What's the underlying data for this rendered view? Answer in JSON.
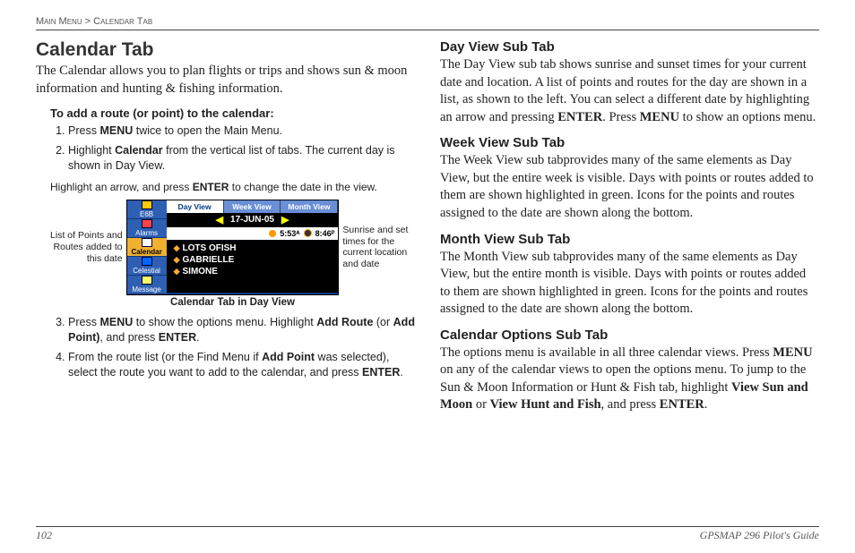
{
  "header": {
    "crumb1": "Main Menu",
    "sep": ">",
    "crumb2": "Calendar Tab"
  },
  "left": {
    "h1": "Calendar Tab",
    "intro": "The Calendar allows you to plan flights or trips and shows sun & moon information and hunting & fishing information.",
    "task_heading": "To add a route (or point) to the calendar:",
    "step1_a": "Press ",
    "step1_key": "MENU",
    "step1_b": " twice to open the Main Menu.",
    "step2_a": "Highlight ",
    "step2_key": "Calendar",
    "step2_b": " from the vertical list of tabs. The current day is shown in Day View.",
    "note_a": "Highlight an arrow, and press ",
    "note_key": "ENTER",
    "note_b": " to change the date in the view.",
    "callout_left": "List of Points and Routes added to this date",
    "callout_right": "Sunrise and set times for the current location and date",
    "screenshot": {
      "nav": [
        "E6B",
        "Alarms",
        "Calendar",
        "Celestial",
        "Message"
      ],
      "nav_selected": 2,
      "tabs": [
        "Day View",
        "Week View",
        "Month View"
      ],
      "tab_selected": 0,
      "date": "17-JUN-05",
      "sunrise": "5:53ᴬ",
      "sunset": "8:46ᴾ",
      "routes": [
        "LOTS OFISH",
        "GABRIELLE",
        "SIMONE"
      ]
    },
    "fig_caption": "Calendar Tab in Day View",
    "step3_a": "Press ",
    "step3_k1": "MENU",
    "step3_b": " to show the options menu. Highlight ",
    "step3_k2": "Add Route",
    "step3_c": " (or ",
    "step3_k3": "Add Point)",
    "step3_d": ", and press ",
    "step3_k4": "ENTER",
    "step3_e": ".",
    "step4_a": "From the route list (or the Find Menu if ",
    "step4_k1": "Add Point",
    "step4_b": " was selected), select the route you want to add to the calendar, and press ",
    "step4_k2": "ENTER",
    "step4_c": "."
  },
  "right": {
    "h_day": "Day View Sub Tab",
    "p_day_a": "The Day View sub tab shows sunrise and sunset times for your current date and location. A list of points and routes for the day are shown in a list, as shown to the left. You can select a different date by highlighting an arrow and pressing ",
    "p_day_k1": "ENTER",
    "p_day_b": ". Press ",
    "p_day_k2": "MENU",
    "p_day_c": " to show an options menu.",
    "h_week": "Week View Sub Tab",
    "p_week": "The Week View sub tabprovides many of the same elements as Day View, but the entire week is visible. Days with points or routes added to them are shown highlighted in green. Icons for the points and routes assigned to the date are shown along the bottom.",
    "h_month": "Month View Sub Tab",
    "p_month": "The Month View sub tabprovides many of the same elements as Day View, but the entire month is visible. Days with points or routes added to them are shown highlighted in green. Icons for the points and routes assigned to the date are shown along the bottom.",
    "h_opt": "Calendar Options Sub Tab",
    "p_opt_a": "The options menu is available in all three calendar views. Press ",
    "p_opt_k1": "MENU",
    "p_opt_b": " on any of the calendar views to open the options menu. To jump to the Sun & Moon Information or Hunt & Fish tab, highlight ",
    "p_opt_k2": "View Sun and Moon",
    "p_opt_c": " or ",
    "p_opt_k3": "View Hunt and Fish",
    "p_opt_d": ", and press ",
    "p_opt_k4": "ENTER",
    "p_opt_e": "."
  },
  "footer": {
    "page": "102",
    "guide": "GPSMAP 296 Pilot's Guide"
  }
}
